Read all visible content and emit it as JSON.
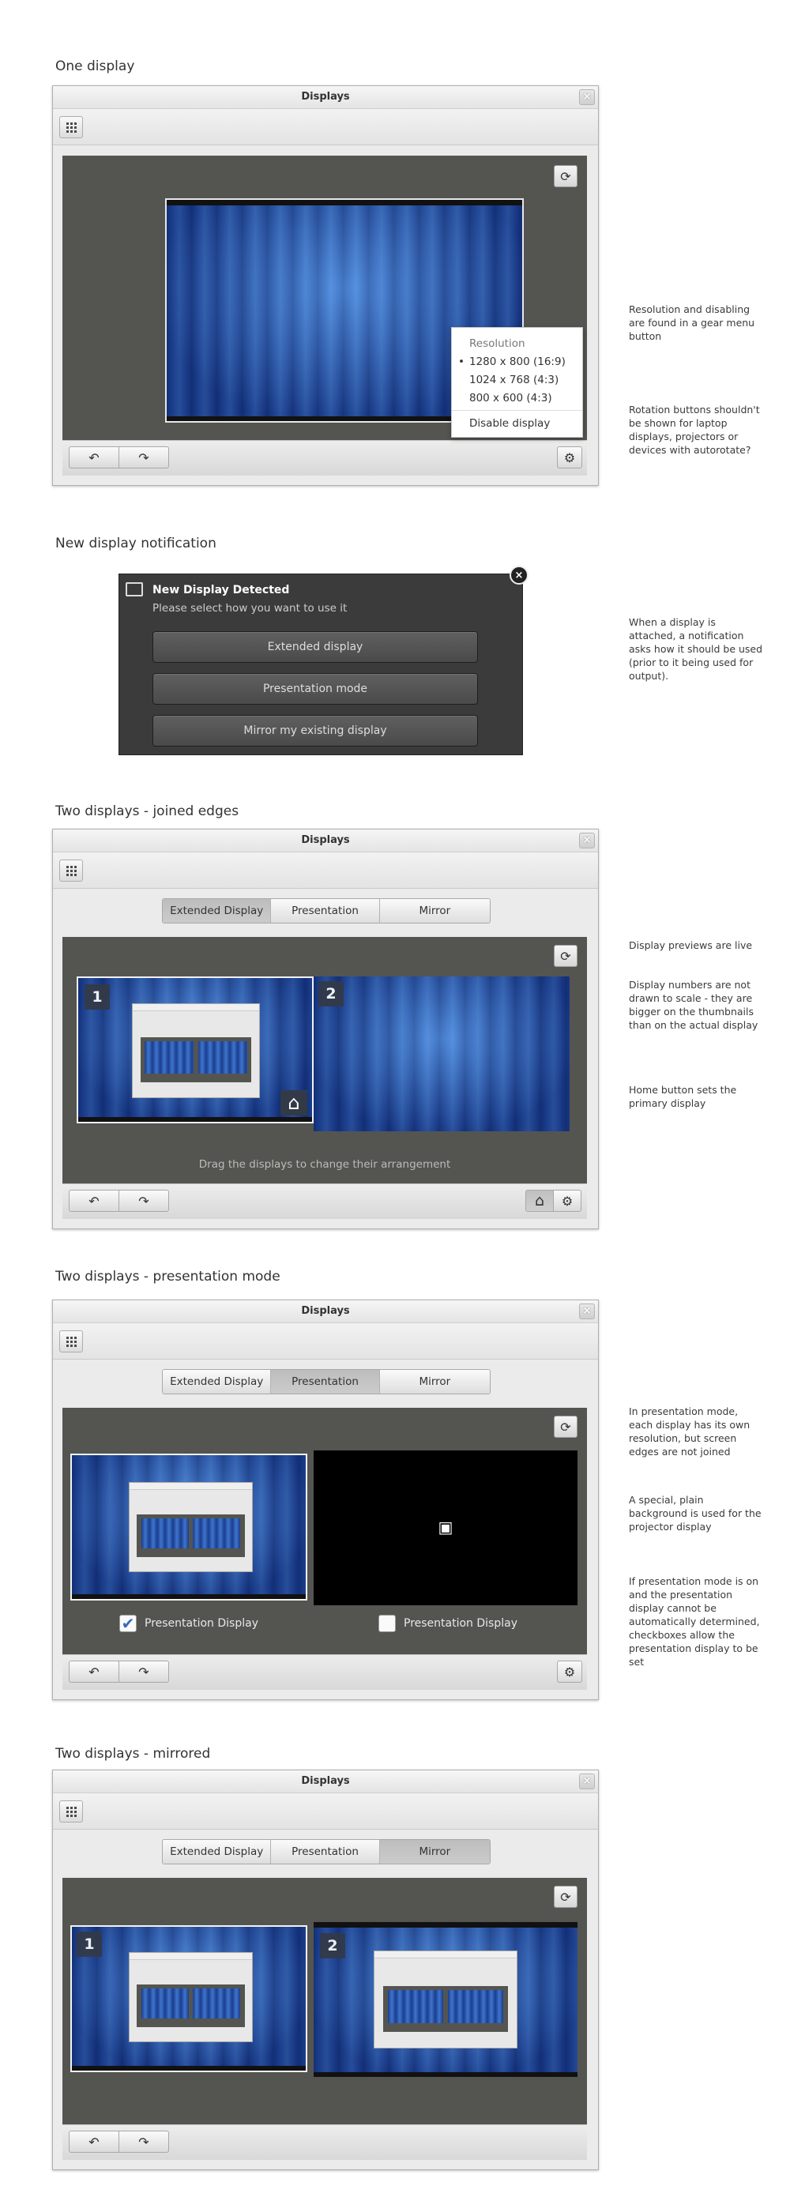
{
  "sections": {
    "one_display": "One display",
    "notification": "New display notification",
    "joined": "Two displays - joined edges",
    "presentation": "Two displays - presentation mode",
    "mirrored": "Two displays - mirrored"
  },
  "window": {
    "title": "Displays",
    "close": "×"
  },
  "modes": {
    "extended": "Extended Display",
    "presentation": "Presentation",
    "mirror": "Mirror"
  },
  "icons": {
    "rotate_left": "↶",
    "rotate_right": "↷",
    "refresh": "⟳",
    "gear": "⚙",
    "home": "⌂",
    "projector": "▣",
    "check": "✔"
  },
  "gear_menu": {
    "header": "Resolution",
    "bullet": "•",
    "options": [
      "1280 x 800 (16:9)",
      "1024 x 768 (4:3)",
      "800 x 600 (4:3)"
    ],
    "disable": "Disable display"
  },
  "notification": {
    "title": "New Display Detected",
    "subtitle": "Please select how you want to use it",
    "buttons": [
      "Extended display",
      "Presentation mode",
      "Mirror my existing display"
    ]
  },
  "joined": {
    "hint": "Drag the displays to change their arrangement",
    "badges": [
      "1",
      "2"
    ]
  },
  "presentation": {
    "checkbox_label": "Presentation Display",
    "checked_first": true
  },
  "notes": {
    "gear_menu": "Resolution and disabling are found in a gear menu button",
    "rotation": "Rotation buttons shouldn't be shown for laptop displays, projectors or devices with autorotate?",
    "notification": "When a display is attached, a notification asks how it should be used (prior to it being used for output).",
    "live": "Display previews are live",
    "scale": "Display numbers are not drawn to scale - they are bigger on the thumbnails than on the actual display",
    "home": "Home button sets the primary display",
    "pres_edges": "In presentation mode, each display has its own resolution, but screen edges are not joined",
    "pres_bg": "A special, plain background is used for the projector display",
    "pres_checkbox": "If presentation mode is on and the presentation display cannot be automatically determined, checkboxes allow the presentation display to be set"
  }
}
